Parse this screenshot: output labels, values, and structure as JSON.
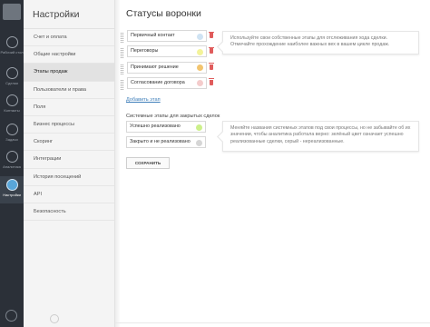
{
  "rail": {
    "items": [
      {
        "label": "Рабочий стол",
        "icon": "dashboard-icon"
      },
      {
        "label": "Сделки",
        "icon": "deals-icon"
      },
      {
        "label": "Контакты",
        "icon": "contacts-icon"
      },
      {
        "label": "Задачи",
        "icon": "tasks-icon"
      },
      {
        "label": "Аналитика",
        "icon": "analytics-icon"
      },
      {
        "label": "Настройки",
        "icon": "settings-icon"
      }
    ]
  },
  "menu": {
    "title": "Настройки",
    "items": [
      "Счет и оплата",
      "Общие настройки",
      "Этапы продаж",
      "Пользователи и права",
      "Поля",
      "Бизнес процессы",
      "Скоринг",
      "Интеграции",
      "История посещений",
      "API",
      "Безопасность"
    ],
    "active_index": 2
  },
  "main": {
    "title": "Статусы воронки",
    "stages": [
      {
        "name": "Первичный контакт",
        "color": "#cfe3f3"
      },
      {
        "name": "Переговоры",
        "color": "#f3f39a"
      },
      {
        "name": "Принимают решение",
        "color": "#f2c46e"
      },
      {
        "name": "Согласование договора",
        "color": "#f4cccc"
      }
    ],
    "add_stage": "Добавить этап",
    "system_label": "Системные этапы для закрытых сделок",
    "system_stages": [
      {
        "name": "Успешно реализовано",
        "color": "#ccf08a"
      },
      {
        "name": "Закрыто и не реализовано",
        "color": "#d6d6d6"
      }
    ],
    "save_label": "СОХРАНИТЬ",
    "hint1": "Используйте свои собственные этапы для отслеживания хода сделки. Отмечайте прохождение наиболее важных вех в вашем цикле продаж.",
    "hint2": "Меняйте названия системных этапов под свои процессы, но не забывайте об их значении, чтобы аналитика работала верно: зелёный цвет означает успешно реализованные сделки, серый - нереализованные."
  }
}
